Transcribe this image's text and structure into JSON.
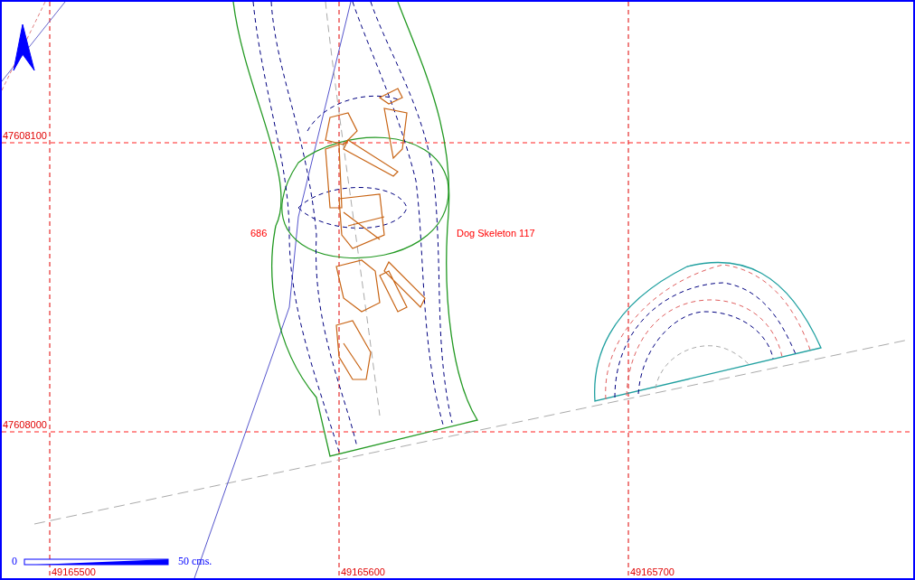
{
  "grid": {
    "northings": [
      "47608100",
      "47608000"
    ],
    "eastings": [
      "49165500",
      "49165600",
      "49165700"
    ]
  },
  "features": [
    {
      "label": "686"
    },
    {
      "label": "Dog Skeleton 117"
    }
  ],
  "scale_bar": {
    "start": "0",
    "end": "50 cms."
  }
}
